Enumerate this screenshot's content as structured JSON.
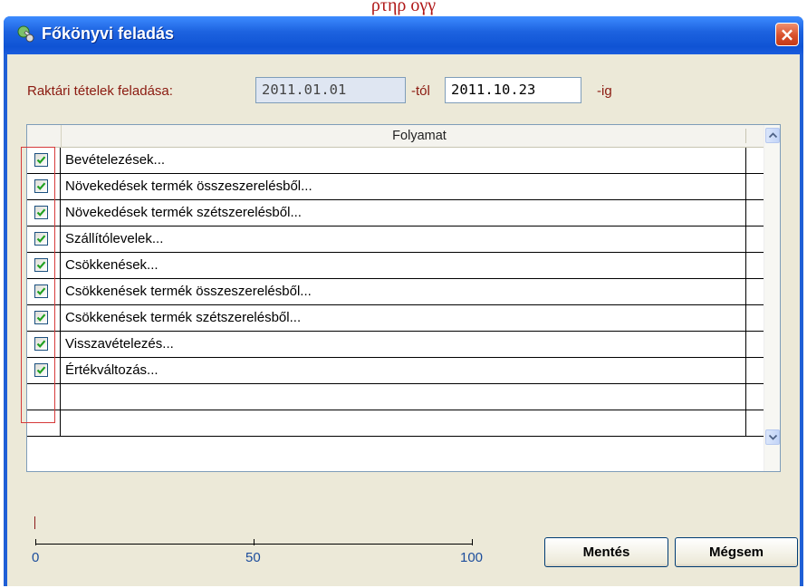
{
  "top_text": "ρτηρ ογγ",
  "window": {
    "title": "Főkönyvi feladás",
    "close_glyph": "×"
  },
  "range": {
    "label": "Raktári tételek feladása:",
    "from_value": "2011.01.01",
    "from_suffix": "-tól",
    "to_value": "2011.10.23",
    "to_suffix": "-ig"
  },
  "grid": {
    "column_header": "Folyamat",
    "rows": [
      {
        "label": "Bevételezések...",
        "checked": true
      },
      {
        "label": "Növekedések termék összeszerelésből...",
        "checked": true
      },
      {
        "label": "Növekedések termék szétszerelésből...",
        "checked": true
      },
      {
        "label": "Szállítólevelek...",
        "checked": true
      },
      {
        "label": "Csökkenések...",
        "checked": true
      },
      {
        "label": "Csökkenések termék összeszerelésből...",
        "checked": true
      },
      {
        "label": "Csökkenések termék szétszerelésből...",
        "checked": true
      },
      {
        "label": "Visszavételezés...",
        "checked": true
      },
      {
        "label": "Értékváltozás...",
        "checked": true
      },
      {
        "label": "",
        "checked": false
      },
      {
        "label": "",
        "checked": false
      }
    ]
  },
  "progress": {
    "value": 0,
    "labels": [
      "0",
      "50",
      "100"
    ]
  },
  "buttons": {
    "save": "Mentés",
    "cancel": "Mégsem"
  },
  "colors": {
    "titlebar": "#1d63e0",
    "label_text": "#8b1a10",
    "highlight": "#d63a3a",
    "checkmark": "#21a121"
  }
}
